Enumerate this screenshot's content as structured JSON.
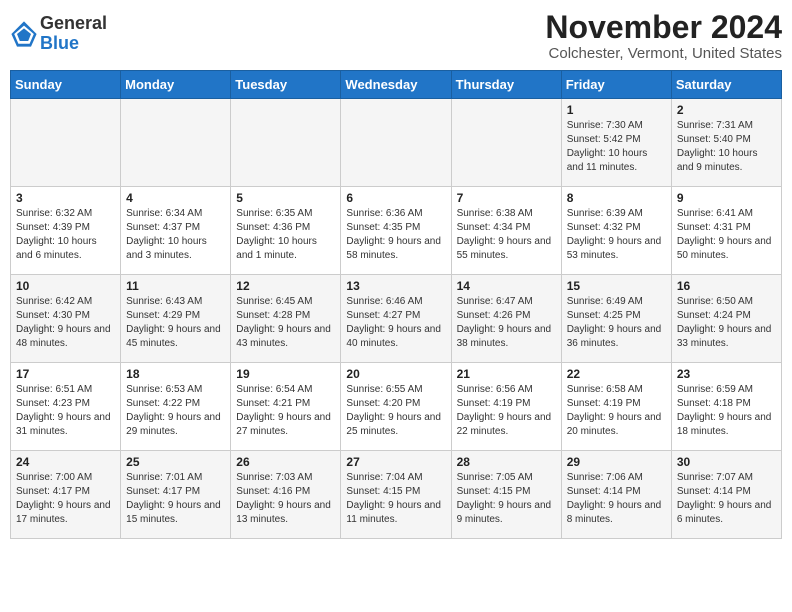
{
  "app": {
    "logo_line1": "General",
    "logo_line2": "Blue"
  },
  "title": "November 2024",
  "subtitle": "Colchester, Vermont, United States",
  "days_of_week": [
    "Sunday",
    "Monday",
    "Tuesday",
    "Wednesday",
    "Thursday",
    "Friday",
    "Saturday"
  ],
  "weeks": [
    [
      {
        "day": "",
        "sunrise": "",
        "sunset": "",
        "daylight": ""
      },
      {
        "day": "",
        "sunrise": "",
        "sunset": "",
        "daylight": ""
      },
      {
        "day": "",
        "sunrise": "",
        "sunset": "",
        "daylight": ""
      },
      {
        "day": "",
        "sunrise": "",
        "sunset": "",
        "daylight": ""
      },
      {
        "day": "",
        "sunrise": "",
        "sunset": "",
        "daylight": ""
      },
      {
        "day": "1",
        "sunrise": "Sunrise: 7:30 AM",
        "sunset": "Sunset: 5:42 PM",
        "daylight": "Daylight: 10 hours and 11 minutes."
      },
      {
        "day": "2",
        "sunrise": "Sunrise: 7:31 AM",
        "sunset": "Sunset: 5:40 PM",
        "daylight": "Daylight: 10 hours and 9 minutes."
      }
    ],
    [
      {
        "day": "3",
        "sunrise": "Sunrise: 6:32 AM",
        "sunset": "Sunset: 4:39 PM",
        "daylight": "Daylight: 10 hours and 6 minutes."
      },
      {
        "day": "4",
        "sunrise": "Sunrise: 6:34 AM",
        "sunset": "Sunset: 4:37 PM",
        "daylight": "Daylight: 10 hours and 3 minutes."
      },
      {
        "day": "5",
        "sunrise": "Sunrise: 6:35 AM",
        "sunset": "Sunset: 4:36 PM",
        "daylight": "Daylight: 10 hours and 1 minute."
      },
      {
        "day": "6",
        "sunrise": "Sunrise: 6:36 AM",
        "sunset": "Sunset: 4:35 PM",
        "daylight": "Daylight: 9 hours and 58 minutes."
      },
      {
        "day": "7",
        "sunrise": "Sunrise: 6:38 AM",
        "sunset": "Sunset: 4:34 PM",
        "daylight": "Daylight: 9 hours and 55 minutes."
      },
      {
        "day": "8",
        "sunrise": "Sunrise: 6:39 AM",
        "sunset": "Sunset: 4:32 PM",
        "daylight": "Daylight: 9 hours and 53 minutes."
      },
      {
        "day": "9",
        "sunrise": "Sunrise: 6:41 AM",
        "sunset": "Sunset: 4:31 PM",
        "daylight": "Daylight: 9 hours and 50 minutes."
      }
    ],
    [
      {
        "day": "10",
        "sunrise": "Sunrise: 6:42 AM",
        "sunset": "Sunset: 4:30 PM",
        "daylight": "Daylight: 9 hours and 48 minutes."
      },
      {
        "day": "11",
        "sunrise": "Sunrise: 6:43 AM",
        "sunset": "Sunset: 4:29 PM",
        "daylight": "Daylight: 9 hours and 45 minutes."
      },
      {
        "day": "12",
        "sunrise": "Sunrise: 6:45 AM",
        "sunset": "Sunset: 4:28 PM",
        "daylight": "Daylight: 9 hours and 43 minutes."
      },
      {
        "day": "13",
        "sunrise": "Sunrise: 6:46 AM",
        "sunset": "Sunset: 4:27 PM",
        "daylight": "Daylight: 9 hours and 40 minutes."
      },
      {
        "day": "14",
        "sunrise": "Sunrise: 6:47 AM",
        "sunset": "Sunset: 4:26 PM",
        "daylight": "Daylight: 9 hours and 38 minutes."
      },
      {
        "day": "15",
        "sunrise": "Sunrise: 6:49 AM",
        "sunset": "Sunset: 4:25 PM",
        "daylight": "Daylight: 9 hours and 36 minutes."
      },
      {
        "day": "16",
        "sunrise": "Sunrise: 6:50 AM",
        "sunset": "Sunset: 4:24 PM",
        "daylight": "Daylight: 9 hours and 33 minutes."
      }
    ],
    [
      {
        "day": "17",
        "sunrise": "Sunrise: 6:51 AM",
        "sunset": "Sunset: 4:23 PM",
        "daylight": "Daylight: 9 hours and 31 minutes."
      },
      {
        "day": "18",
        "sunrise": "Sunrise: 6:53 AM",
        "sunset": "Sunset: 4:22 PM",
        "daylight": "Daylight: 9 hours and 29 minutes."
      },
      {
        "day": "19",
        "sunrise": "Sunrise: 6:54 AM",
        "sunset": "Sunset: 4:21 PM",
        "daylight": "Daylight: 9 hours and 27 minutes."
      },
      {
        "day": "20",
        "sunrise": "Sunrise: 6:55 AM",
        "sunset": "Sunset: 4:20 PM",
        "daylight": "Daylight: 9 hours and 25 minutes."
      },
      {
        "day": "21",
        "sunrise": "Sunrise: 6:56 AM",
        "sunset": "Sunset: 4:19 PM",
        "daylight": "Daylight: 9 hours and 22 minutes."
      },
      {
        "day": "22",
        "sunrise": "Sunrise: 6:58 AM",
        "sunset": "Sunset: 4:19 PM",
        "daylight": "Daylight: 9 hours and 20 minutes."
      },
      {
        "day": "23",
        "sunrise": "Sunrise: 6:59 AM",
        "sunset": "Sunset: 4:18 PM",
        "daylight": "Daylight: 9 hours and 18 minutes."
      }
    ],
    [
      {
        "day": "24",
        "sunrise": "Sunrise: 7:00 AM",
        "sunset": "Sunset: 4:17 PM",
        "daylight": "Daylight: 9 hours and 17 minutes."
      },
      {
        "day": "25",
        "sunrise": "Sunrise: 7:01 AM",
        "sunset": "Sunset: 4:17 PM",
        "daylight": "Daylight: 9 hours and 15 minutes."
      },
      {
        "day": "26",
        "sunrise": "Sunrise: 7:03 AM",
        "sunset": "Sunset: 4:16 PM",
        "daylight": "Daylight: 9 hours and 13 minutes."
      },
      {
        "day": "27",
        "sunrise": "Sunrise: 7:04 AM",
        "sunset": "Sunset: 4:15 PM",
        "daylight": "Daylight: 9 hours and 11 minutes."
      },
      {
        "day": "28",
        "sunrise": "Sunrise: 7:05 AM",
        "sunset": "Sunset: 4:15 PM",
        "daylight": "Daylight: 9 hours and 9 minutes."
      },
      {
        "day": "29",
        "sunrise": "Sunrise: 7:06 AM",
        "sunset": "Sunset: 4:14 PM",
        "daylight": "Daylight: 9 hours and 8 minutes."
      },
      {
        "day": "30",
        "sunrise": "Sunrise: 7:07 AM",
        "sunset": "Sunset: 4:14 PM",
        "daylight": "Daylight: 9 hours and 6 minutes."
      }
    ]
  ]
}
